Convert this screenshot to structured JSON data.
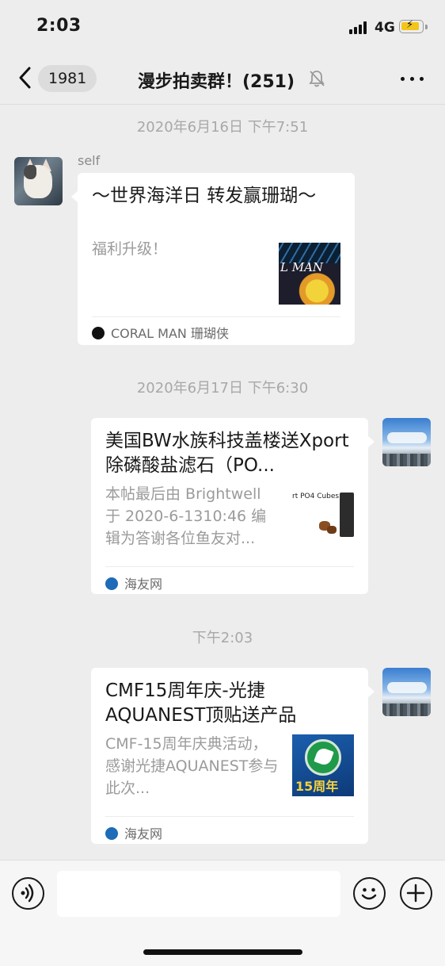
{
  "status_bar": {
    "time": "2:03",
    "network": "4G",
    "battery_color": "#f2c51b"
  },
  "nav": {
    "back_icon": "chevron-left-icon",
    "unread_badge": "1981",
    "title": "漫步拍卖群！(251)",
    "mute_icon": "bell-slash-icon",
    "more_icon": "more-dots-icon"
  },
  "messages": [
    {
      "timestamp": "2020年6月16日 下午7:51",
      "sender": "self",
      "title": "～世界海洋日 转发赢珊瑚～",
      "description": "福利升级！",
      "thumb_text": "L MAN",
      "source": "CORAL MAN 珊瑚侠"
    },
    {
      "timestamp": "2020年6月17日 下午6:30",
      "title": "美国BW水族科技盖楼送Xport除磷酸盐滤石（PO...",
      "description": "本帖最后由 Brightwell 于 2020-6-1310:46 编辑为答谢各位鱼友对...",
      "thumb_text": "rt PO4 Cubes",
      "source": "海友网"
    },
    {
      "timestamp": "下午2:03",
      "title": "CMF15周年庆-光捷AQUANEST顶贴送产品",
      "description": "CMF-15周年庆典活动，感谢光捷AQUANEST参与此次...",
      "thumb_text": "15周年",
      "source": "海友网"
    }
  ],
  "input_bar": {
    "voice_icon": "voice-icon",
    "emoji_icon": "emoji-icon",
    "plus_icon": "plus-circle-icon",
    "text_value": ""
  },
  "colors": {
    "background": "#ededed",
    "bubble": "#ffffff",
    "timestamp": "#a8a8a8",
    "source_icon_blue": "#1e6bb8"
  }
}
